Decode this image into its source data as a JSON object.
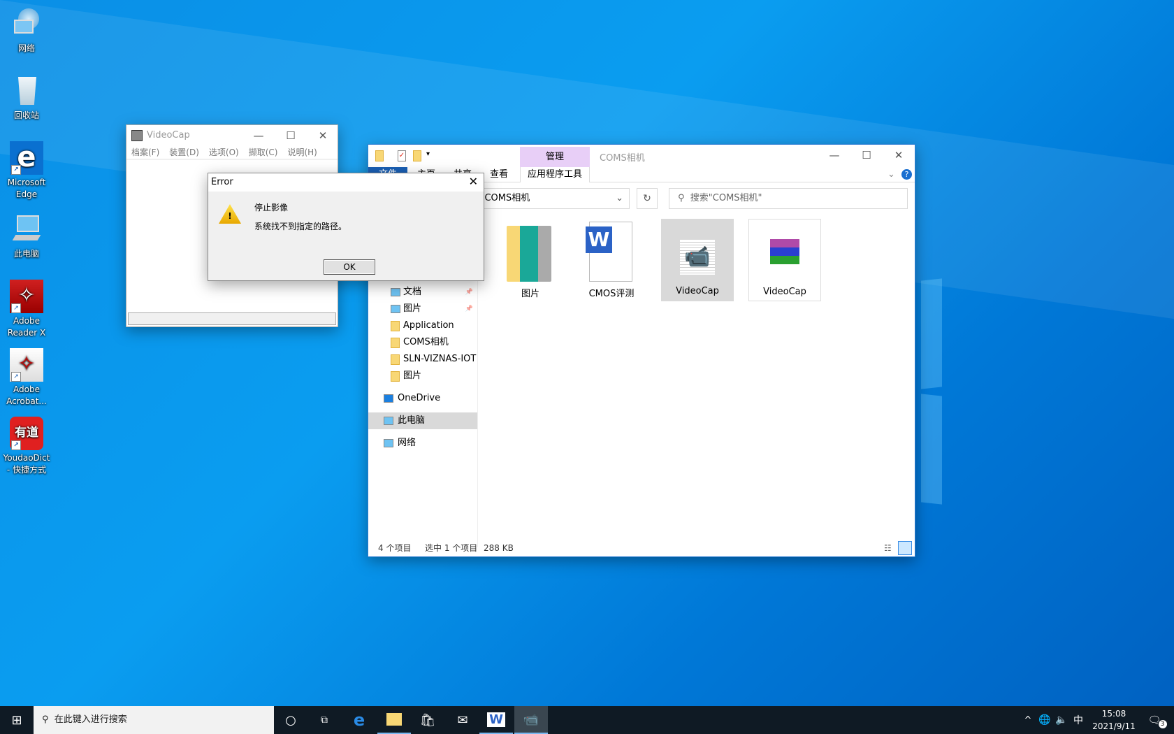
{
  "desktop": {
    "icons": [
      {
        "label1": "网络",
        "icon": "network-icon"
      },
      {
        "label1": "回收站",
        "icon": "recycle-bin-icon"
      },
      {
        "label1": "Microsoft",
        "label2": "Edge",
        "icon": "edge-icon"
      },
      {
        "label1": "此电脑",
        "icon": "this-pc-icon"
      },
      {
        "label1": "Adobe",
        "label2": "Reader X",
        "icon": "adobe-reader-icon"
      },
      {
        "label1": "Adobe",
        "label2": "Acrobat...",
        "icon": "adobe-acrobat-icon"
      },
      {
        "label1": "YoudaoDict",
        "label2": "- 快捷方式",
        "icon": "youdao-icon",
        "logo_text": "有道"
      }
    ]
  },
  "videocap": {
    "title": "VideoCap",
    "menu": [
      "档案(F)",
      "装置(D)",
      "选项(O)",
      "撷取(C)",
      "说明(H)"
    ]
  },
  "error": {
    "title": "Error",
    "heading": "停止影像",
    "message": "系统找不到指定的路径。",
    "ok": "OK"
  },
  "explorer": {
    "title": "COMS相机",
    "context_tab_group": "管理",
    "tabs": [
      "文件",
      "主页",
      "共享",
      "查看",
      "应用程序工具"
    ],
    "address": "COMS相机",
    "address_prefix": "i",
    "search_placeholder": "搜索\"COMS相机\"",
    "nav": [
      {
        "label": "文档",
        "pinned": true
      },
      {
        "label": "图片",
        "pinned": true
      },
      {
        "label": "Application"
      },
      {
        "label": "COMS相机"
      },
      {
        "label": "SLN-VIZNAS-IOT"
      },
      {
        "label": "图片"
      },
      {
        "label": "OneDrive"
      },
      {
        "label": "此电脑",
        "selected": true
      },
      {
        "label": "网络"
      }
    ],
    "files": [
      {
        "name": "图片",
        "type": "folder"
      },
      {
        "name": "CMOS评测",
        "type": "word-document"
      },
      {
        "name": "VideoCap",
        "type": "application",
        "selected": true
      },
      {
        "name": "VideoCap",
        "type": "rar-archive"
      }
    ],
    "status": {
      "count": "4 个项目",
      "selected": "选中 1 个项目",
      "size": "288 KB"
    }
  },
  "taskbar": {
    "search_placeholder": "在此键入进行搜索",
    "time": "15:08",
    "date": "2021/9/11",
    "ime": "中",
    "notifications": "3"
  },
  "colors": {
    "accent": "#0078d7",
    "context_tab": "#e8cff7",
    "selection": "#d9d9d9"
  }
}
